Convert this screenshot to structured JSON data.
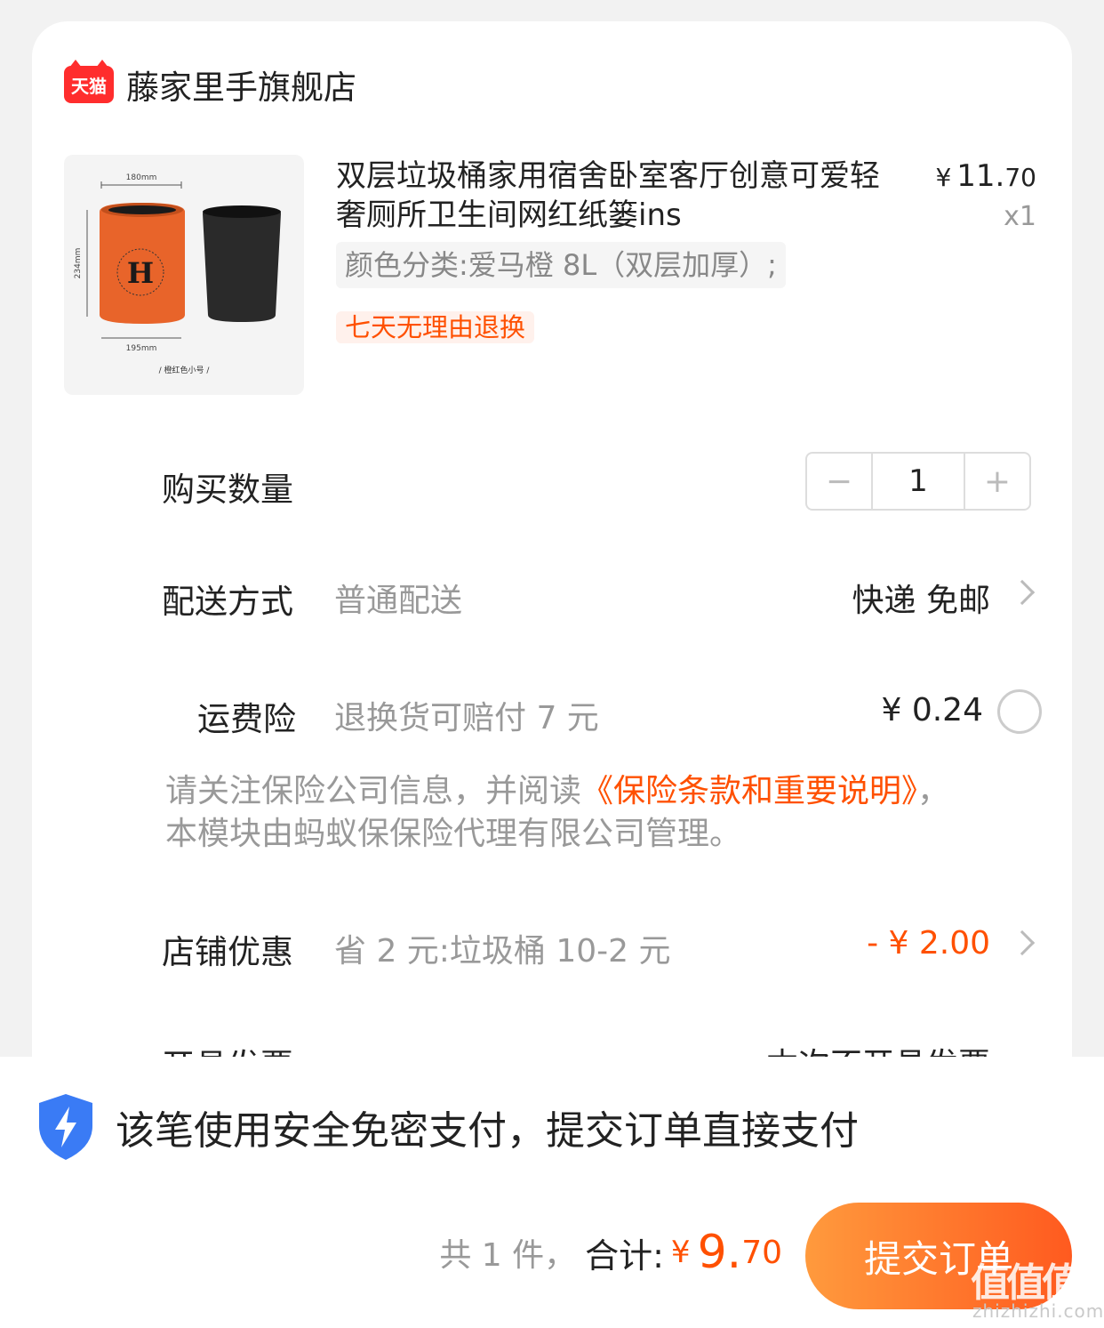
{
  "store": {
    "badge": "天猫",
    "name": "藤家里手旗舰店"
  },
  "product": {
    "title": "双层垃圾桶家用宿舍卧室客厅创意可爱轻奢厕所卫生间网红纸篓ins",
    "price_currency": "¥",
    "price_int": "11.",
    "price_dec": "70",
    "quantity_label": "x1",
    "sku": "颜色分类:爱马橙 8L（双层加厚）;",
    "service_tag": "七天无理由退换",
    "image": {
      "width_label": "180mm",
      "height_label": "234mm",
      "bottom_label": "195mm",
      "caption": "/ 橙红色小号 /",
      "letter": "H",
      "orange": "#e8642a",
      "black": "#2a2a2a"
    }
  },
  "quantity": {
    "label": "购买数量",
    "value": "1",
    "minus": "−",
    "plus": "+"
  },
  "delivery": {
    "label": "配送方式",
    "method": "普通配送",
    "value": "快递 免邮"
  },
  "insurance": {
    "label": "运费险",
    "desc": "退换货可赔付 7 元",
    "price": "¥ 0.24",
    "notice_pre": "请关注保险公司信息，并阅读",
    "notice_link": "《保险条款和重要说明》",
    "notice_post": "，本模块由蚂蚁保保险代理有限公司管理。"
  },
  "discount": {
    "label": "店铺优惠",
    "desc": "省 2 元:垃圾桶 10-2 元",
    "value": "- ¥ 2.00"
  },
  "invoice": {
    "label": "开具发票",
    "value": "本次不开具发票"
  },
  "footer": {
    "secure_text": "该笔使用安全免密支付，提交订单直接支付",
    "count_text": "共 1 件，",
    "total_label": "合计:",
    "total_currency": "¥",
    "total_int": "9.",
    "total_dec": "70",
    "submit": "提交订单"
  },
  "watermark": {
    "main": "值值值",
    "sub": "zhizhizhi.com"
  },
  "colors": {
    "accent": "#ff5000",
    "tmall_red": "#ff2d2d",
    "shield_blue": "#3a7bf5"
  }
}
